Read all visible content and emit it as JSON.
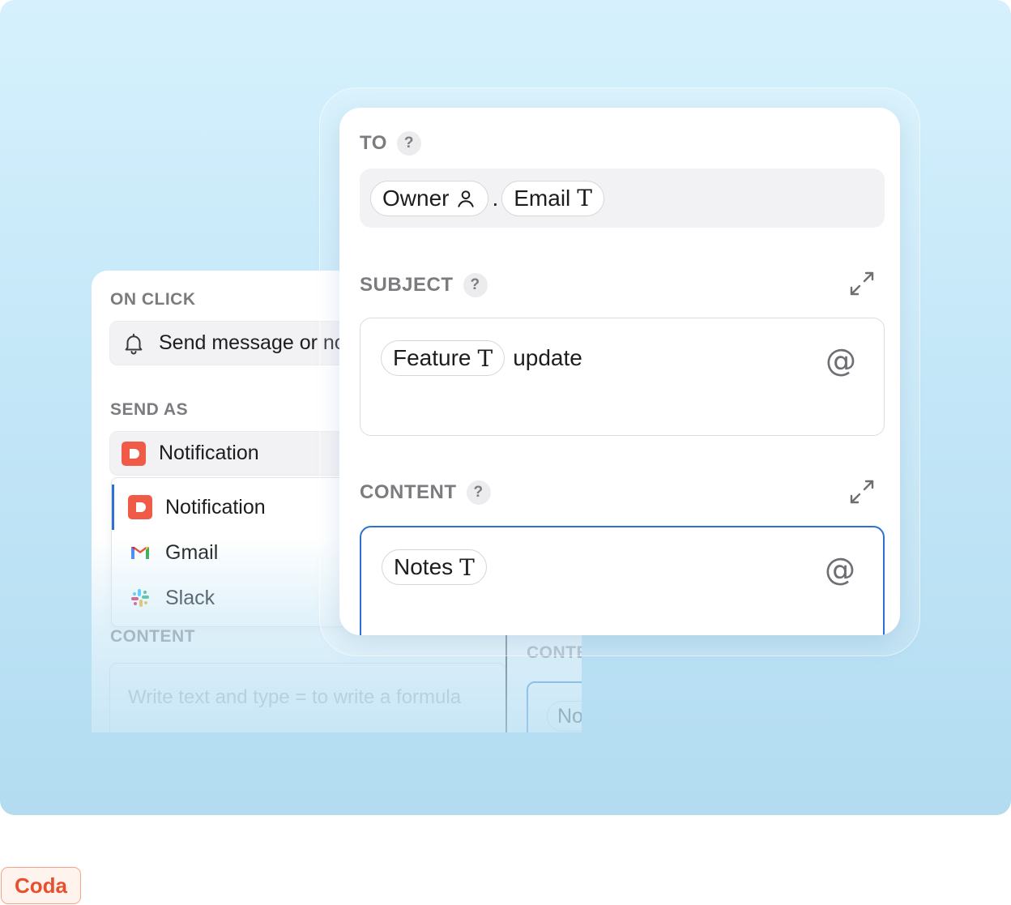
{
  "back_panel": {
    "on_click_label": "ON CLICK",
    "action_value": "Send message or notification",
    "action_icon": "bell-icon",
    "send_as_label": "SEND AS",
    "send_as_value": "Notification",
    "send_as_icon": "coda-icon",
    "dropdown_options": [
      {
        "label": "Notification",
        "icon": "coda-icon",
        "selected": true
      },
      {
        "label": "Gmail",
        "icon": "gmail-icon",
        "selected": false
      },
      {
        "label": "Slack",
        "icon": "slack-icon",
        "selected": false
      }
    ],
    "content_label": "CONTENT",
    "content_placeholder": "Write text and type = to write a formula",
    "content_label_right": "CONTENT",
    "content_chip_right": "Notes"
  },
  "front_panel": {
    "to": {
      "label": "TO",
      "help": "?",
      "chips": [
        {
          "text": "Owner",
          "icon": "person-icon"
        },
        {
          "text": "Email",
          "glyph": "T"
        }
      ],
      "separator": "."
    },
    "subject": {
      "label": "SUBJECT",
      "help": "?",
      "chip": {
        "text": "Feature",
        "glyph": "T"
      },
      "text": "update",
      "mention_symbol": "@",
      "expand_icon": "expand-icon"
    },
    "content": {
      "label": "CONTENT",
      "help": "?",
      "chip": {
        "text": "Notes",
        "glyph": "T"
      },
      "mention_symbol": "@",
      "expand_icon": "expand-icon"
    }
  },
  "brand": {
    "label": "Coda",
    "color": "#e8502d"
  },
  "colors": {
    "accent": "#2f6fd6",
    "coda_red": "#ef5b47",
    "label_gray": "#7c7c80"
  }
}
